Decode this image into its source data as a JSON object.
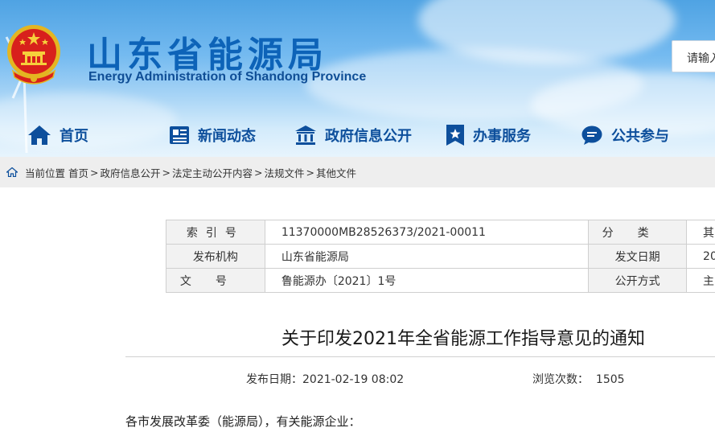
{
  "site": {
    "title_cn": "山东省能源局",
    "title_en": "Energy Administration of Shandong Province",
    "search_placeholder": "请输入"
  },
  "nav": [
    {
      "label": "首页",
      "icon": "home-icon"
    },
    {
      "label": "新闻动态",
      "icon": "news-icon"
    },
    {
      "label": "政府信息公开",
      "icon": "government-building-icon"
    },
    {
      "label": "办事服务",
      "icon": "service-badge-icon"
    },
    {
      "label": "公共参与",
      "icon": "chat-bubble-icon"
    }
  ],
  "breadcrumb": {
    "prefix": "当前位置",
    "items": [
      "首页",
      "政府信息公开",
      "法定主动公开内容",
      "法规文件",
      "其他文件"
    ],
    "separator": ">"
  },
  "meta": {
    "rows": [
      {
        "label1": "索引号",
        "value1": "11370000MB28526373/2021-00011",
        "label2": "分类",
        "value2": "其"
      },
      {
        "label1": "发布机构",
        "value1": "山东省能源局",
        "label2": "发文日期",
        "value2": "20"
      },
      {
        "label1": "文号",
        "value1": "鲁能源办〔2021〕1号",
        "label2": "公开方式",
        "value2": "主"
      }
    ]
  },
  "article": {
    "title": "关于印发2021年全省能源工作指导意见的通知",
    "publish_label": "发布日期：",
    "publish_date": "2021-02-19 08:02",
    "views_label": "浏览次数：",
    "views": "1505",
    "salutation": "各市发展改革委（能源局），有关能源企业："
  },
  "colors": {
    "brand_blue": "#0d63b8",
    "nav_blue": "#0d4f9c",
    "breadcrumb_bg": "#eeeeee",
    "table_label_bg": "#f2f2f2"
  }
}
